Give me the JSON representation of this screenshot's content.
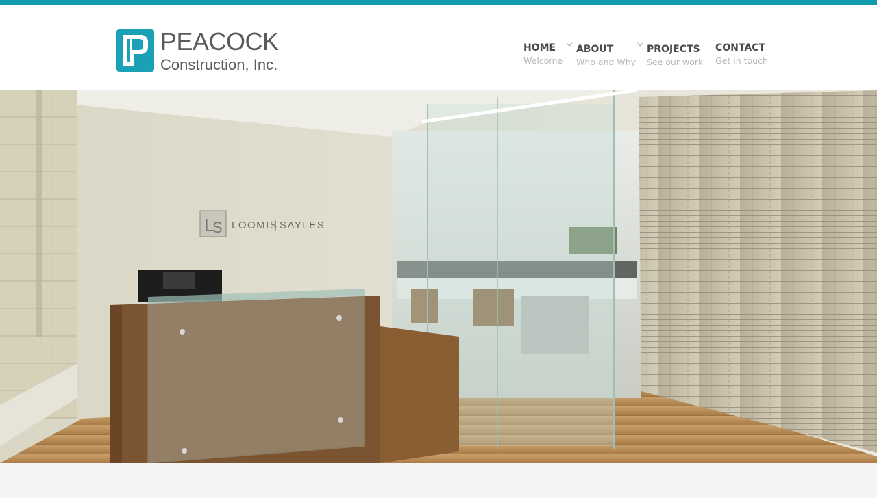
{
  "brand": {
    "name": "PEACOCK",
    "subtitle": "Construction, Inc.",
    "accent": "#0f9aad",
    "logo_color": "#1aa1b5",
    "text_color": "#5a5a5a"
  },
  "nav": {
    "items": [
      {
        "label": "HOME",
        "sub": "Welcome",
        "dropdown": false
      },
      {
        "label": "ABOUT",
        "sub": "Who and Why",
        "dropdown": true
      },
      {
        "label": "PROJECTS",
        "sub": "See our work",
        "dropdown": true
      },
      {
        "label": "CONTACT",
        "sub": "Get in touch",
        "dropdown": false
      }
    ]
  },
  "hero": {
    "sign_left": "LOOMIS",
    "sign_right": "SAYLES"
  }
}
